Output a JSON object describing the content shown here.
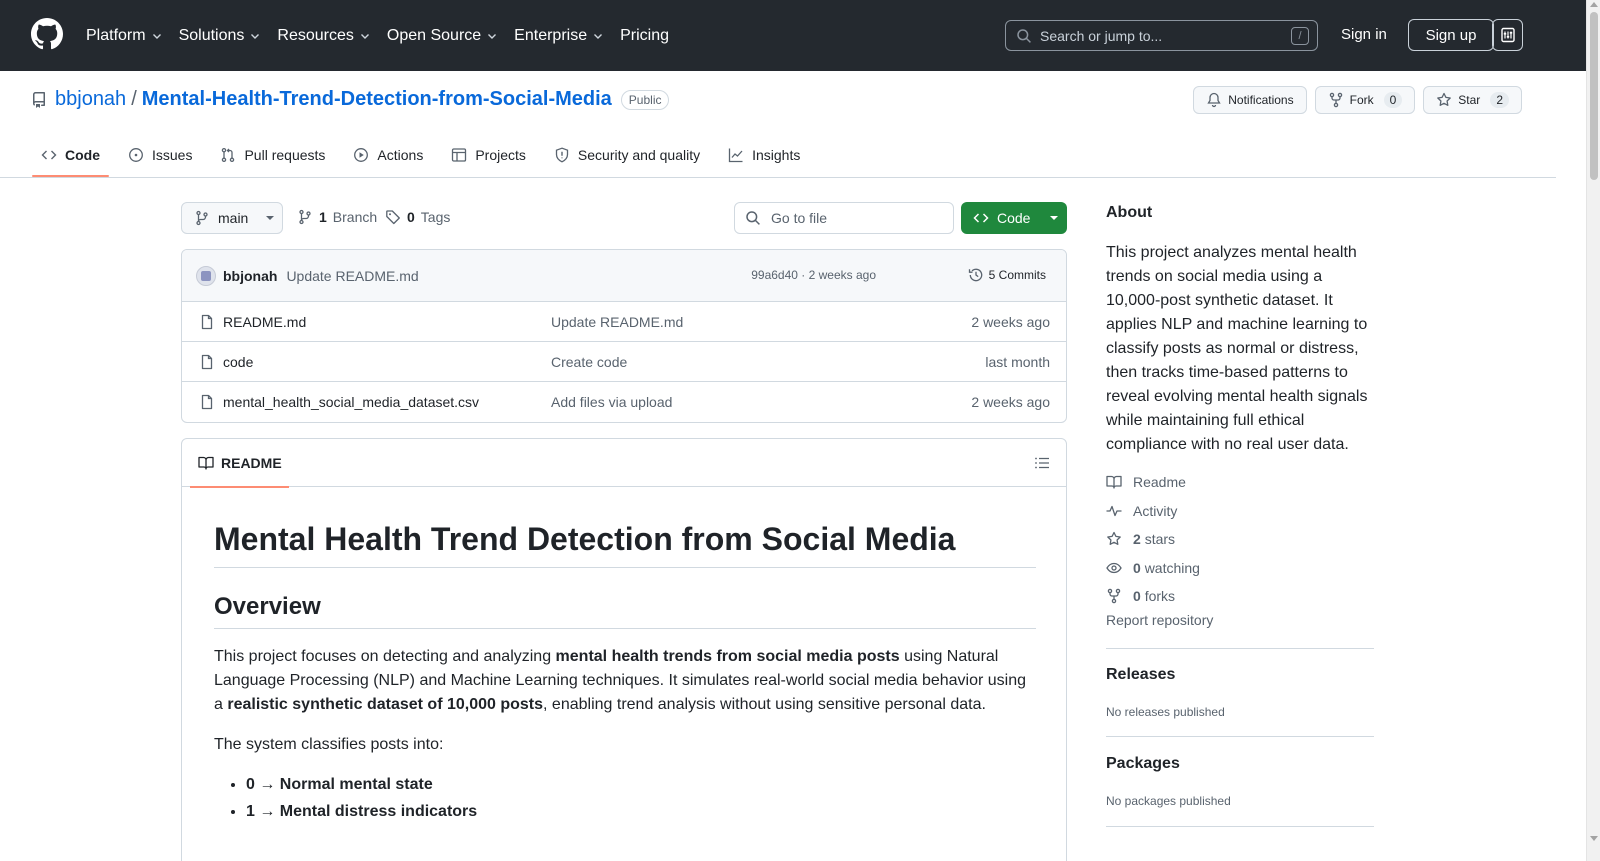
{
  "header": {
    "nav": [
      {
        "label": "Platform",
        "has_dropdown": true
      },
      {
        "label": "Solutions",
        "has_dropdown": true
      },
      {
        "label": "Resources",
        "has_dropdown": true
      },
      {
        "label": "Open Source",
        "has_dropdown": true
      },
      {
        "label": "Enterprise",
        "has_dropdown": true
      },
      {
        "label": "Pricing",
        "has_dropdown": false
      }
    ],
    "search_placeholder": "Search or jump to...",
    "search_shortcut": "/",
    "sign_in": "Sign in",
    "sign_up": "Sign up"
  },
  "repo": {
    "owner": "bbjonah",
    "separator": "/",
    "name": "Mental-Health-Trend-Detection-from-Social-Media",
    "visibility": "Public",
    "notifications_label": "Notifications",
    "fork_label": "Fork",
    "fork_count": "0",
    "star_label": "Star",
    "star_count": "2"
  },
  "repo_nav": {
    "code": "Code",
    "issues": "Issues",
    "pull_requests": "Pull requests",
    "actions": "Actions",
    "projects": "Projects",
    "security": "Security and quality",
    "insights": "Insights",
    "active": "Code"
  },
  "toolbar": {
    "branch": "main",
    "branch_count": "1",
    "branch_label": "Branch",
    "tag_count": "0",
    "tag_label": "Tags",
    "goto_file_placeholder": "Go to file",
    "code_button": "Code"
  },
  "latest_commit": {
    "author": "bbjonah",
    "message": "Update README.md",
    "meta": "99a6d40 · 2 weeks ago",
    "commits_label": "5 Commits"
  },
  "files": [
    {
      "name": "README.md",
      "message": "Update README.md",
      "date": "2 weeks ago"
    },
    {
      "name": "code",
      "message": "Create code",
      "date": "last month"
    },
    {
      "name": "mental_health_social_media_dataset.csv",
      "message": "Add files via upload",
      "date": "2 weeks ago"
    }
  ],
  "readme": {
    "tab_label": "README",
    "h1": "Mental Health Trend Detection from Social Media",
    "h2_overview": "Overview",
    "p1_a": "This project focuses on detecting and analyzing ",
    "p1_b": "mental health trends from social media posts",
    "p1_c": " using Natural Language Processing (NLP) and Machine Learning techniques. It simulates real-world social media behavior using a ",
    "p1_d": "realistic synthetic dataset of 10,000 posts",
    "p1_e": ", enabling trend analysis without using sensitive personal data.",
    "p2": "The system classifies posts into:",
    "list": [
      "0 → Normal mental state",
      "1 → Mental distress indicators"
    ]
  },
  "sidebar": {
    "about_title": "About",
    "description": "This project analyzes mental health trends on social media using a 10,000-post synthetic dataset. It applies NLP and machine learning to classify posts as normal or distress, then tracks time-based patterns to reveal evolving mental health signals while maintaining full ethical compliance with no real user data.",
    "readme": "Readme",
    "activity": "Activity",
    "stars_count": "2",
    "stars_label": "stars",
    "watching_count": "0",
    "watching_label": "watching",
    "forks_count": "0",
    "forks_label": "forks",
    "report": "Report repository",
    "releases_title": "Releases",
    "releases_empty": "No releases published",
    "packages_title": "Packages",
    "packages_empty": "No packages published"
  },
  "colors": {
    "header_bg": "#24292f",
    "link": "#0969da",
    "code_button": "#1f883d",
    "active_tab_underline": "#fd8c73"
  }
}
